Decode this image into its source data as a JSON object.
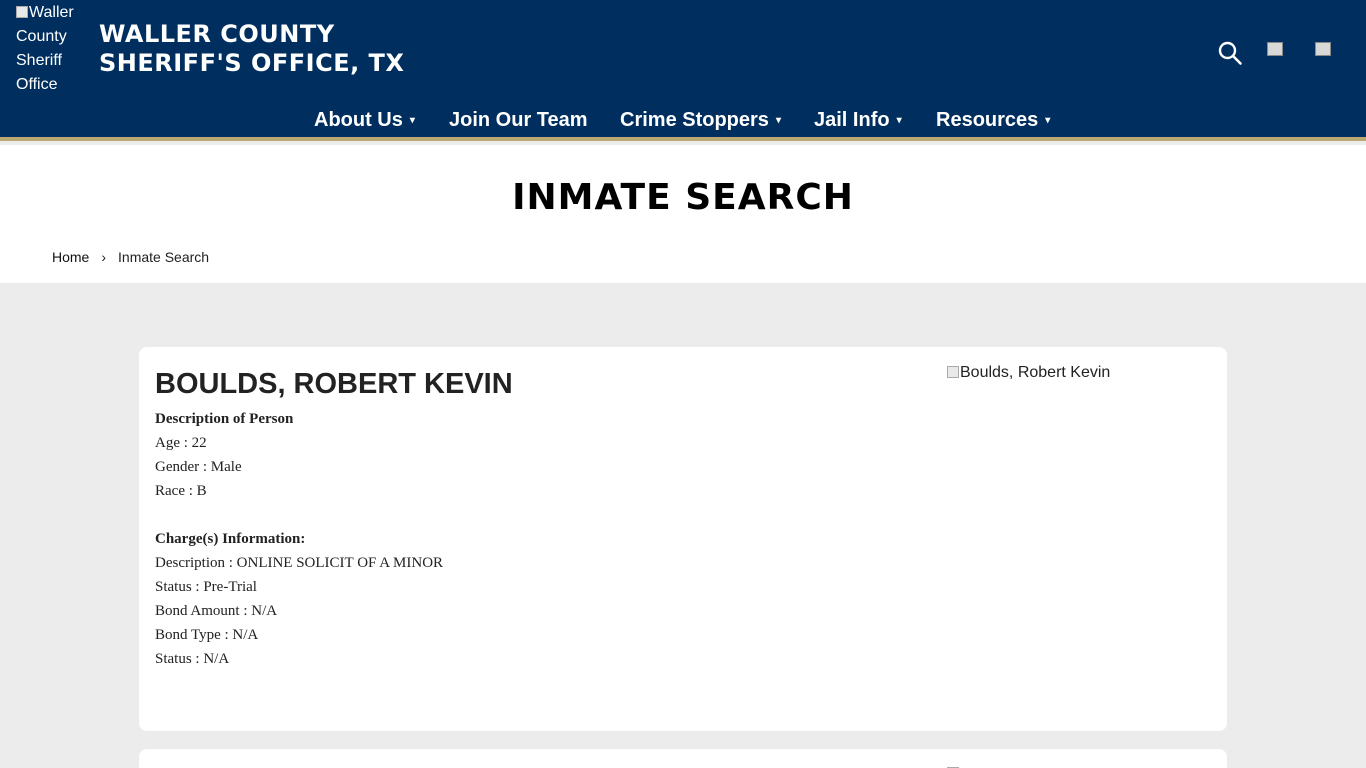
{
  "header": {
    "logo_alt": "Waller County Sheriff Office",
    "title_line1": "WALLER COUNTY",
    "title_line2": "SHERIFF'S OFFICE, TX",
    "icons": [
      "search-icon",
      "facebook-icon",
      "twitter-icon"
    ]
  },
  "nav": {
    "items": [
      {
        "label": "About Us",
        "dropdown": true
      },
      {
        "label": "Join Our Team",
        "dropdown": false
      },
      {
        "label": "Crime Stoppers",
        "dropdown": true
      },
      {
        "label": "Jail Info",
        "dropdown": true
      },
      {
        "label": "Resources",
        "dropdown": true
      }
    ],
    "caret": "▾"
  },
  "page": {
    "title": "INMATE SEARCH"
  },
  "breadcrumb": {
    "home": "Home",
    "separator": "›",
    "current": "Inmate Search"
  },
  "inmate": {
    "name": "BOULDS, ROBERT KEVIN",
    "photo_alt": "Boulds, Robert Kevin",
    "description_heading": "Description of Person",
    "age": "Age : 22",
    "gender": "Gender : Male",
    "race": "Race : B",
    "charges_heading": "Charge(s) Information:",
    "charge_description": "Description : ONLINE SOLICIT OF A MINOR",
    "charge_status": "Status : Pre-Trial",
    "bond_amount": "Bond Amount : N/A",
    "bond_type": "Bond Type : N/A",
    "status": "Status : N/A"
  },
  "colors": {
    "header_bg": "#002f5f",
    "header_accent": "#b9a874",
    "page_bg": "#ececec"
  }
}
